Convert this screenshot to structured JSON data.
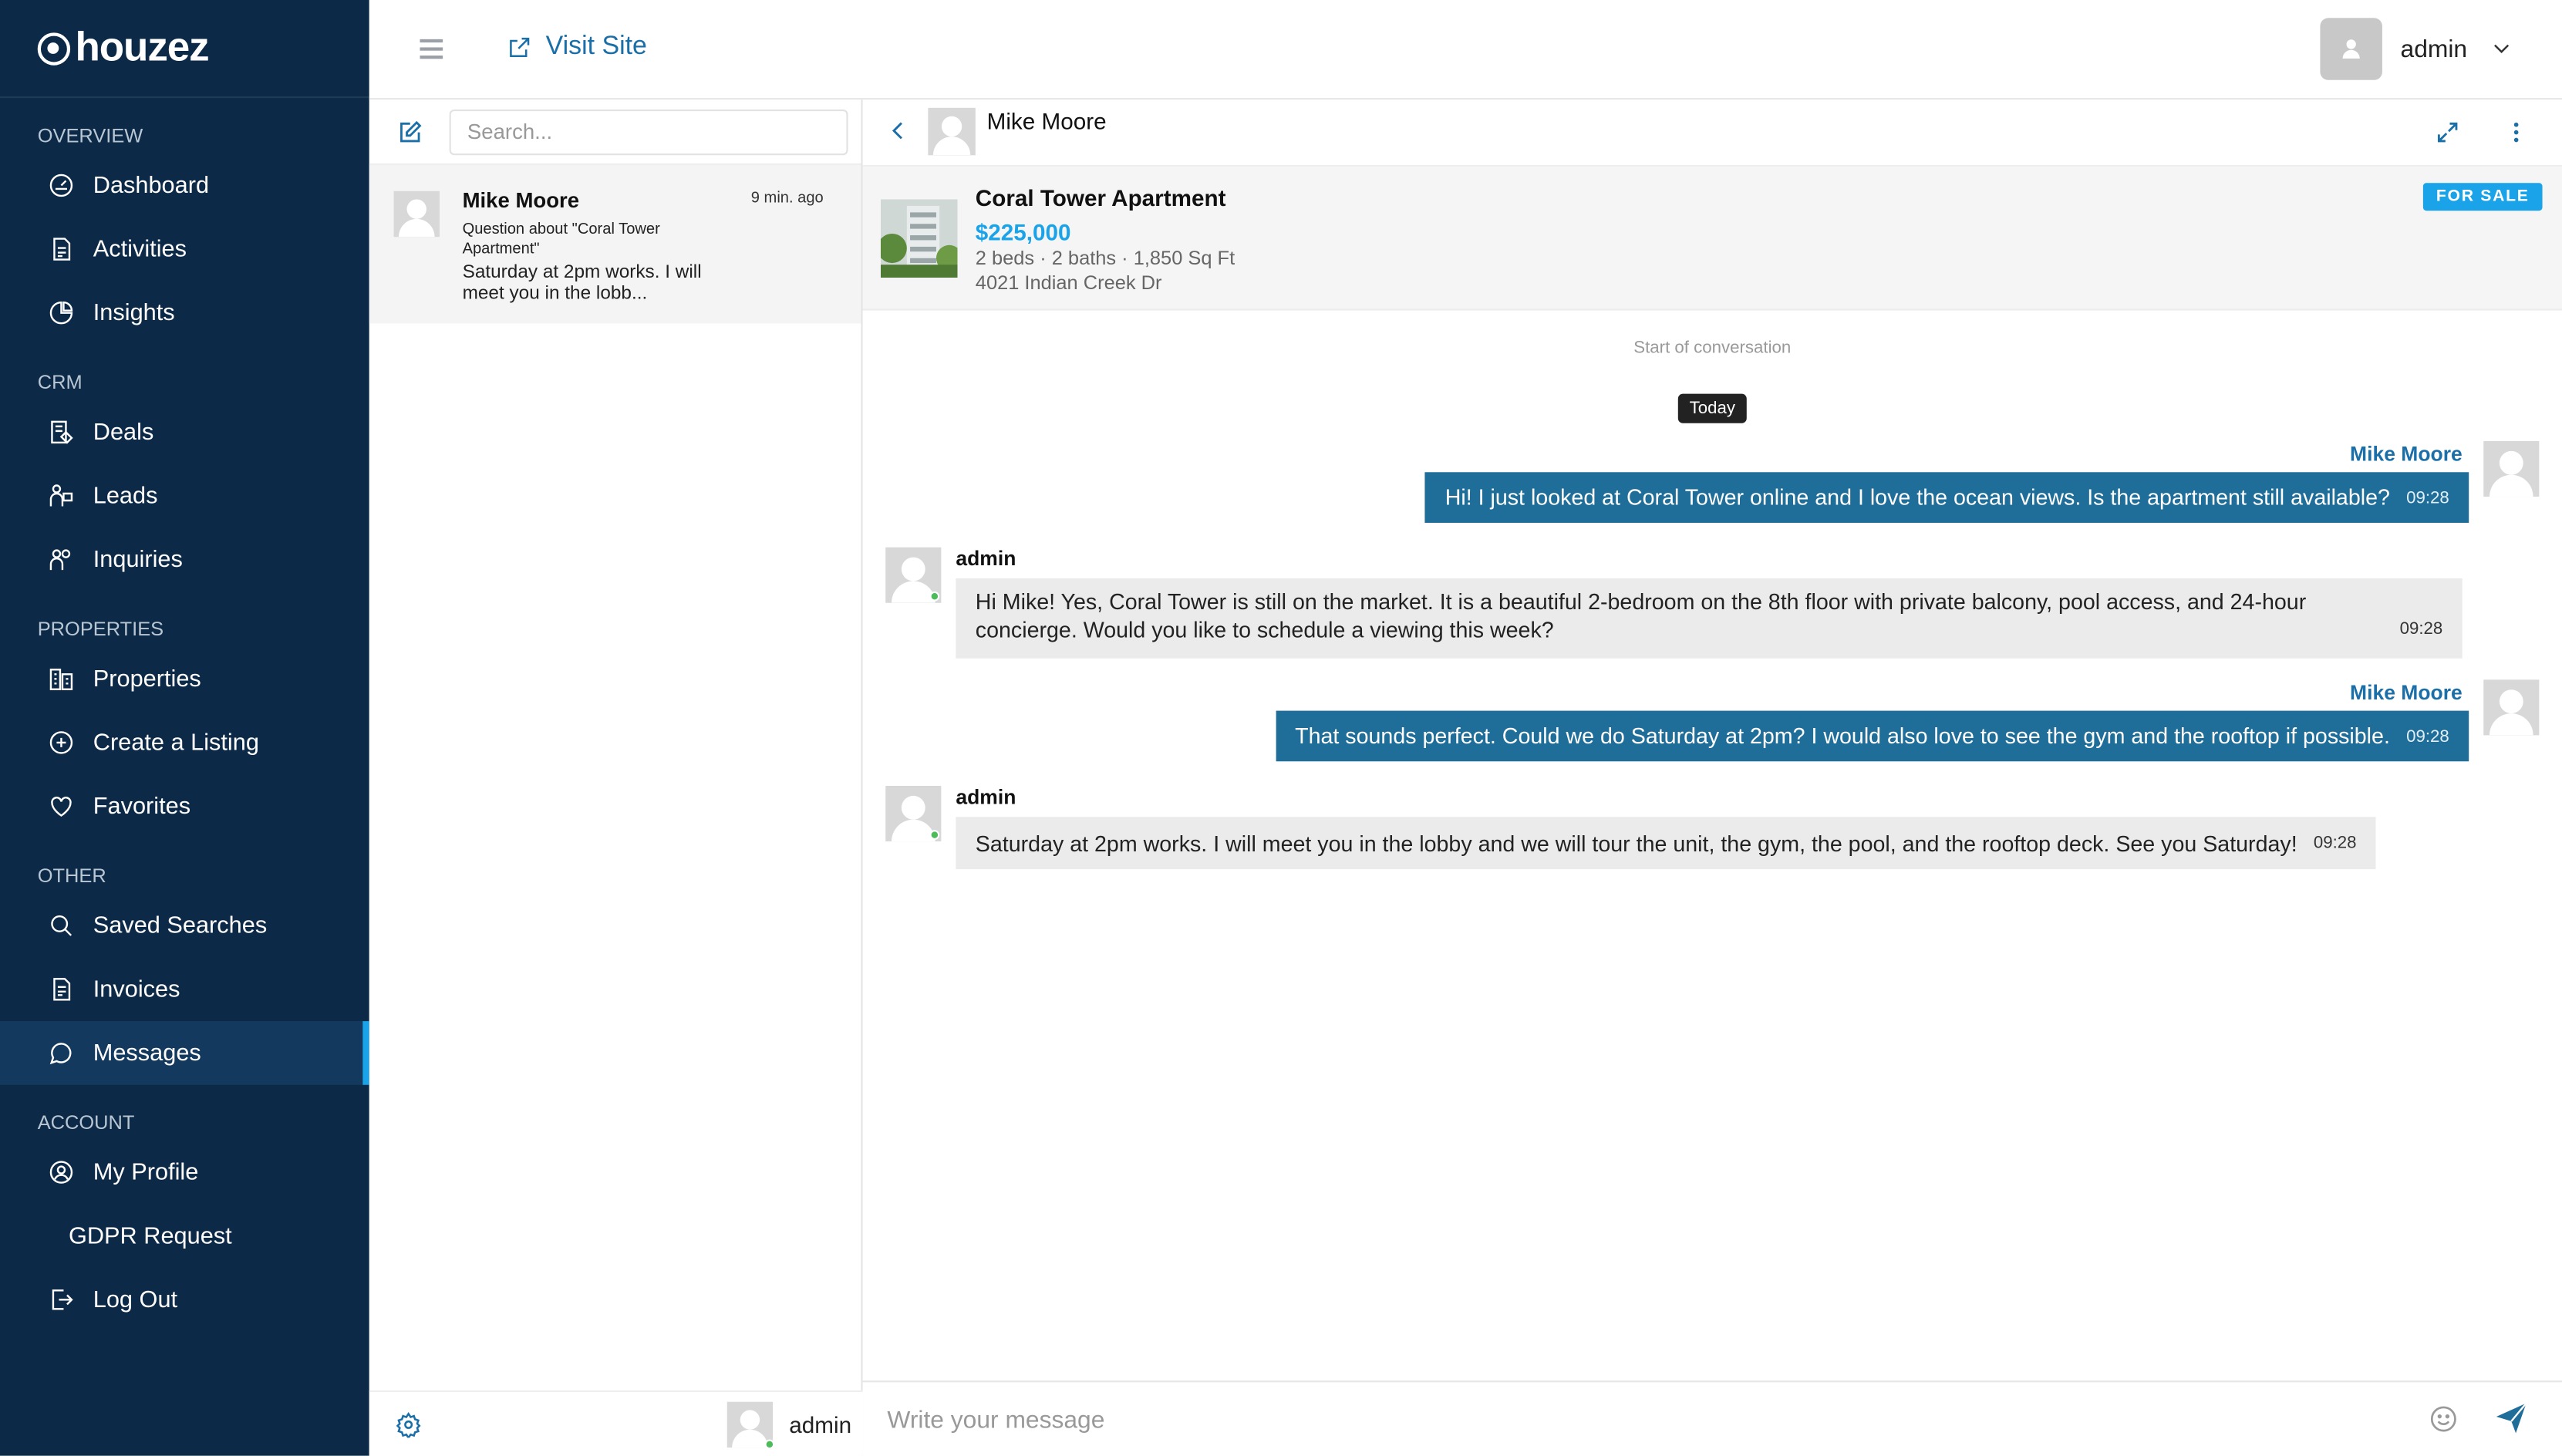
{
  "brand": {
    "name": "houzez"
  },
  "sidebar": {
    "sections": [
      {
        "title": "OVERVIEW",
        "items": [
          {
            "label": "Dashboard",
            "icon": "dashboard-icon"
          },
          {
            "label": "Activities",
            "icon": "activities-icon"
          },
          {
            "label": "Insights",
            "icon": "insights-icon"
          }
        ]
      },
      {
        "title": "CRM",
        "items": [
          {
            "label": "Deals",
            "icon": "deals-icon"
          },
          {
            "label": "Leads",
            "icon": "leads-icon"
          },
          {
            "label": "Inquiries",
            "icon": "inquiries-icon"
          }
        ]
      },
      {
        "title": "PROPERTIES",
        "items": [
          {
            "label": "Properties",
            "icon": "properties-icon"
          },
          {
            "label": "Create a Listing",
            "icon": "plus-circle-icon"
          },
          {
            "label": "Favorites",
            "icon": "heart-icon"
          }
        ]
      },
      {
        "title": "OTHER",
        "items": [
          {
            "label": "Saved Searches",
            "icon": "search-icon"
          },
          {
            "label": "Invoices",
            "icon": "invoice-icon"
          },
          {
            "label": "Messages",
            "icon": "chat-bubble-icon",
            "active": true
          }
        ]
      },
      {
        "title": "ACCOUNT",
        "items": [
          {
            "label": "My Profile",
            "icon": "profile-icon"
          },
          {
            "label": "GDPR Request",
            "icon": ""
          },
          {
            "label": "Log Out",
            "icon": "logout-icon"
          }
        ]
      }
    ]
  },
  "topbar": {
    "visit_label": "Visit Site",
    "user_name": "admin"
  },
  "conversations": {
    "search_placeholder": "Search...",
    "items": [
      {
        "name": "Mike Moore",
        "time": "9 min. ago",
        "subject": "Question about \"Coral Tower Apartment\"",
        "preview": "Saturday at 2pm works. I will meet you in the lobb..."
      }
    ],
    "footer_user": "admin"
  },
  "chat": {
    "contact_name": "Mike Moore",
    "property": {
      "title": "Coral Tower Apartment",
      "price": "$225,000",
      "meta": "2 beds · 2 baths · 1,850 Sq Ft",
      "address": "4021 Indian Creek Dr",
      "status": "FOR SALE"
    },
    "start_label": "Start of conversation",
    "day_label": "Today",
    "messages": [
      {
        "direction": "out",
        "sender": "Mike Moore",
        "text": "Hi! I just looked at Coral Tower online and I love the ocean views. Is the apartment still available?",
        "time": "09:28"
      },
      {
        "direction": "in",
        "sender": "admin",
        "text": "Hi Mike! Yes, Coral Tower is still on the market. It is a beautiful 2-bedroom on the 8th floor with private balcony, pool access, and 24-hour concierge. Would you like to schedule a viewing this week?",
        "time": "09:28"
      },
      {
        "direction": "out",
        "sender": "Mike Moore",
        "text": "That sounds perfect. Could we do Saturday at 2pm? I would also love to see the gym and the rooftop if possible.",
        "time": "09:28"
      },
      {
        "direction": "in",
        "sender": "admin",
        "text": "Saturday at 2pm works. I will meet you in the lobby and we will tour the unit, the gym, the pool, and the rooftop deck. See you Saturday!",
        "time": "09:28"
      }
    ],
    "composer_placeholder": "Write your message"
  },
  "colors": {
    "sidebar_bg": "#0c2a47",
    "accent": "#1aa3e8",
    "outgoing_bubble": "#1f6e9a",
    "incoming_bubble": "#ebebeb",
    "link": "#1b6fa8"
  }
}
